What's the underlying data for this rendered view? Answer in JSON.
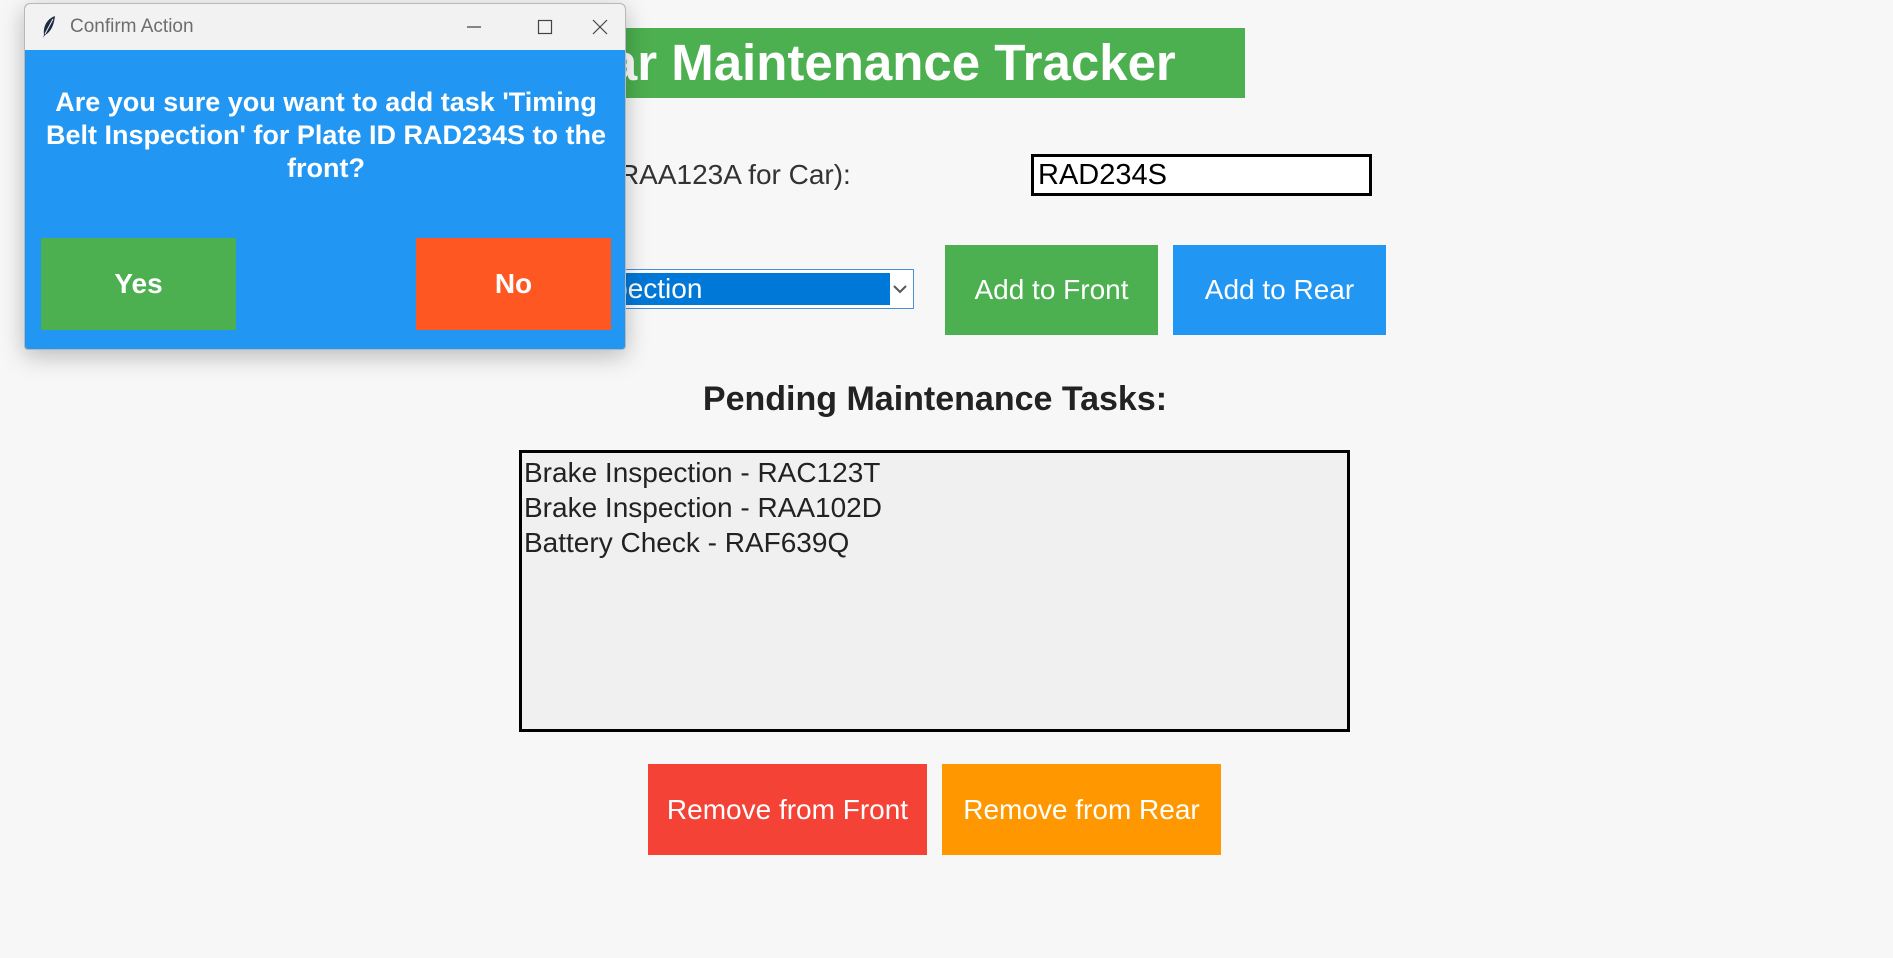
{
  "app": {
    "title": "Car Maintenance Tracker"
  },
  "form": {
    "plate_label": "Plate ID (e.g., RAA123A for Car):",
    "plate_value": "RAD234S",
    "task_selected": "Timing Belt Inspection",
    "add_front_label": "Add to Front",
    "add_rear_label": "Add to Rear"
  },
  "pending": {
    "heading": "Pending Maintenance Tasks:",
    "items": [
      "Brake Inspection - RAC123T",
      "Brake Inspection - RAA102D",
      "Battery Check - RAF639Q"
    ]
  },
  "actions": {
    "remove_front_label": "Remove from Front",
    "remove_rear_label": "Remove from Rear"
  },
  "dialog": {
    "title": "Confirm Action",
    "message": "Are you sure you want to add task 'Timing Belt Inspection' for Plate ID RAD234S to the front?",
    "yes_label": "Yes",
    "no_label": "No"
  },
  "colors": {
    "title_bg": "#4caf50",
    "add_front": "#4caf50",
    "add_rear": "#2196f3",
    "remove_front": "#f44336",
    "remove_rear": "#ff9800",
    "dialog_bg": "#2196f3",
    "dialog_no": "#ff5722"
  },
  "icons": {
    "app_icon": "feather-icon",
    "dropdown": "chevron-down-icon",
    "minimize": "minimize-icon",
    "maximize": "maximize-icon",
    "close": "close-icon"
  }
}
